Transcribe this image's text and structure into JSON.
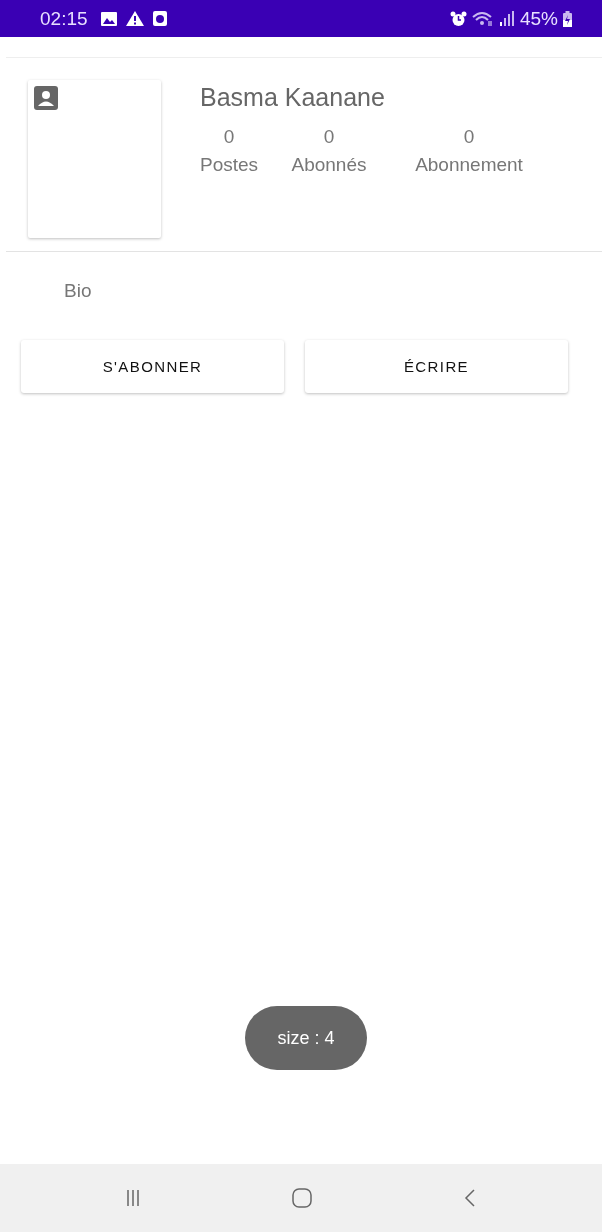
{
  "status_bar": {
    "time": "02:15",
    "battery": "45%"
  },
  "profile": {
    "name": "Basma Kaanane",
    "stats": [
      {
        "count": "0",
        "label": "Postes"
      },
      {
        "count": "0",
        "label": "Abonnés"
      },
      {
        "count": "0",
        "label": "Abonnement"
      }
    ]
  },
  "bio": "Bio",
  "buttons": [
    "S'ABONNER",
    "ÉCRIRE"
  ],
  "toast": "size : 4"
}
